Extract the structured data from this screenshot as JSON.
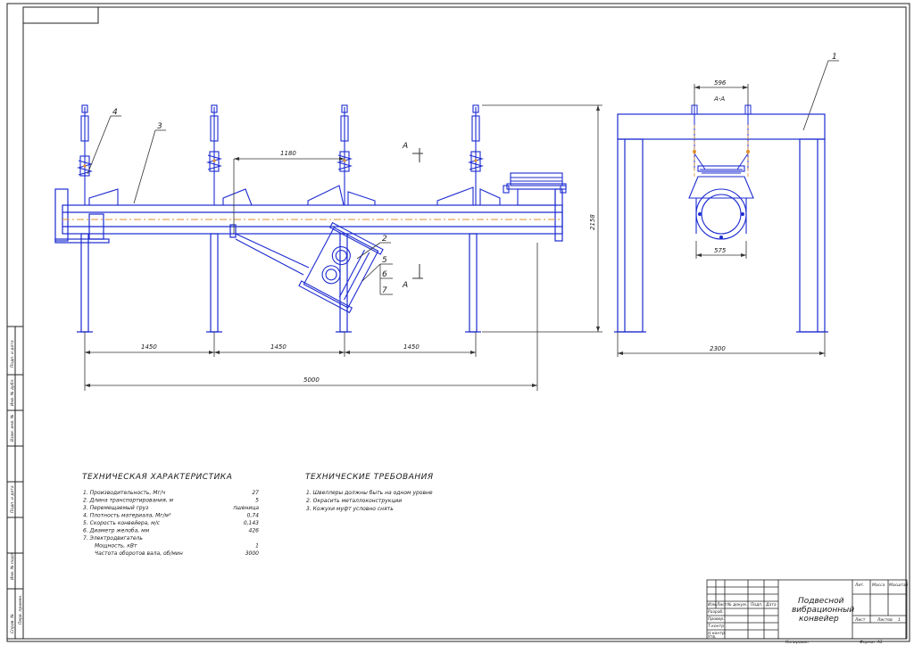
{
  "dimensions": {
    "d1180": "1180",
    "d1450_a": "1450",
    "d1450_b": "1450",
    "d1450_c": "1450",
    "d5000": "5000",
    "d2158": "2158",
    "d596": "596",
    "d575": "575",
    "d2300": "2300"
  },
  "section_marks": {
    "a_top": "А",
    "a_bottom": "А",
    "aa_view": "А-А"
  },
  "leaders": {
    "p1": "1",
    "p2": "2",
    "p3": "3",
    "p4": "4",
    "p5": "5",
    "p6": "6",
    "p7": "7"
  },
  "tech_char": {
    "title": "ТЕХНИЧЕСКАЯ ХАРАКТЕРИСТИКА",
    "rows": [
      {
        "label": "1. Производительность, Мг/ч",
        "value": "27"
      },
      {
        "label": "2. Длина транспортирования, м",
        "value": "5"
      },
      {
        "label": "3. Перемещаемый груз",
        "value": "пшеница"
      },
      {
        "label": "4. Плотность материала, Мг/м³",
        "value": "0,74"
      },
      {
        "label": "5. Скорость конвейера, м/с",
        "value": "0,143"
      },
      {
        "label": "6. Диаметр желоба, мм",
        "value": "426"
      },
      {
        "label": "7. Электродвигатель",
        "value": ""
      },
      {
        "label": "Мощность, кВт",
        "value": "1"
      },
      {
        "label": "Частота оборотов вала, об/мин",
        "value": "3000"
      }
    ]
  },
  "tech_req": {
    "title": "ТЕХНИЧЕСКИЕ ТРЕБОВАНИЯ",
    "rows": [
      "1. Швеллеры должны быть на одном уровне",
      "2. Окрасить металлоконструкции",
      "3. Кожухи муфт условно снять"
    ]
  },
  "title_block": {
    "name_line1": "Подвесной",
    "name_line2": "вибрационный",
    "name_line3": "конвейер",
    "lit": "Лит.",
    "mass": "Масса",
    "scale": "Масштаб",
    "sheet": "Лист",
    "sheets": "Листов",
    "sheets_count": "1",
    "col_izm": "Изм.",
    "col_list": "Лист",
    "col_doc": "№ докум.",
    "col_sign": "Подп.",
    "col_date": "Дата",
    "r_razrab": "Разраб.",
    "r_prov": "Провер.",
    "r_tkontr": "Т.контр.",
    "r_nkontr": "Н.контр.",
    "r_utv": "Утв.",
    "copy": "Копировал",
    "format": "Формат А1"
  },
  "side_strip": [
    "Подп. и дата",
    "Инв. № дубл.",
    "Взам. инв. №",
    "Подп. и дата",
    "Инв. № подл.",
    "Справ. №",
    "Перв. примен."
  ],
  "colors": {
    "outline": "#1c2bd0",
    "frame": "#222222",
    "axis": "#e09030",
    "dim": "#333333"
  }
}
